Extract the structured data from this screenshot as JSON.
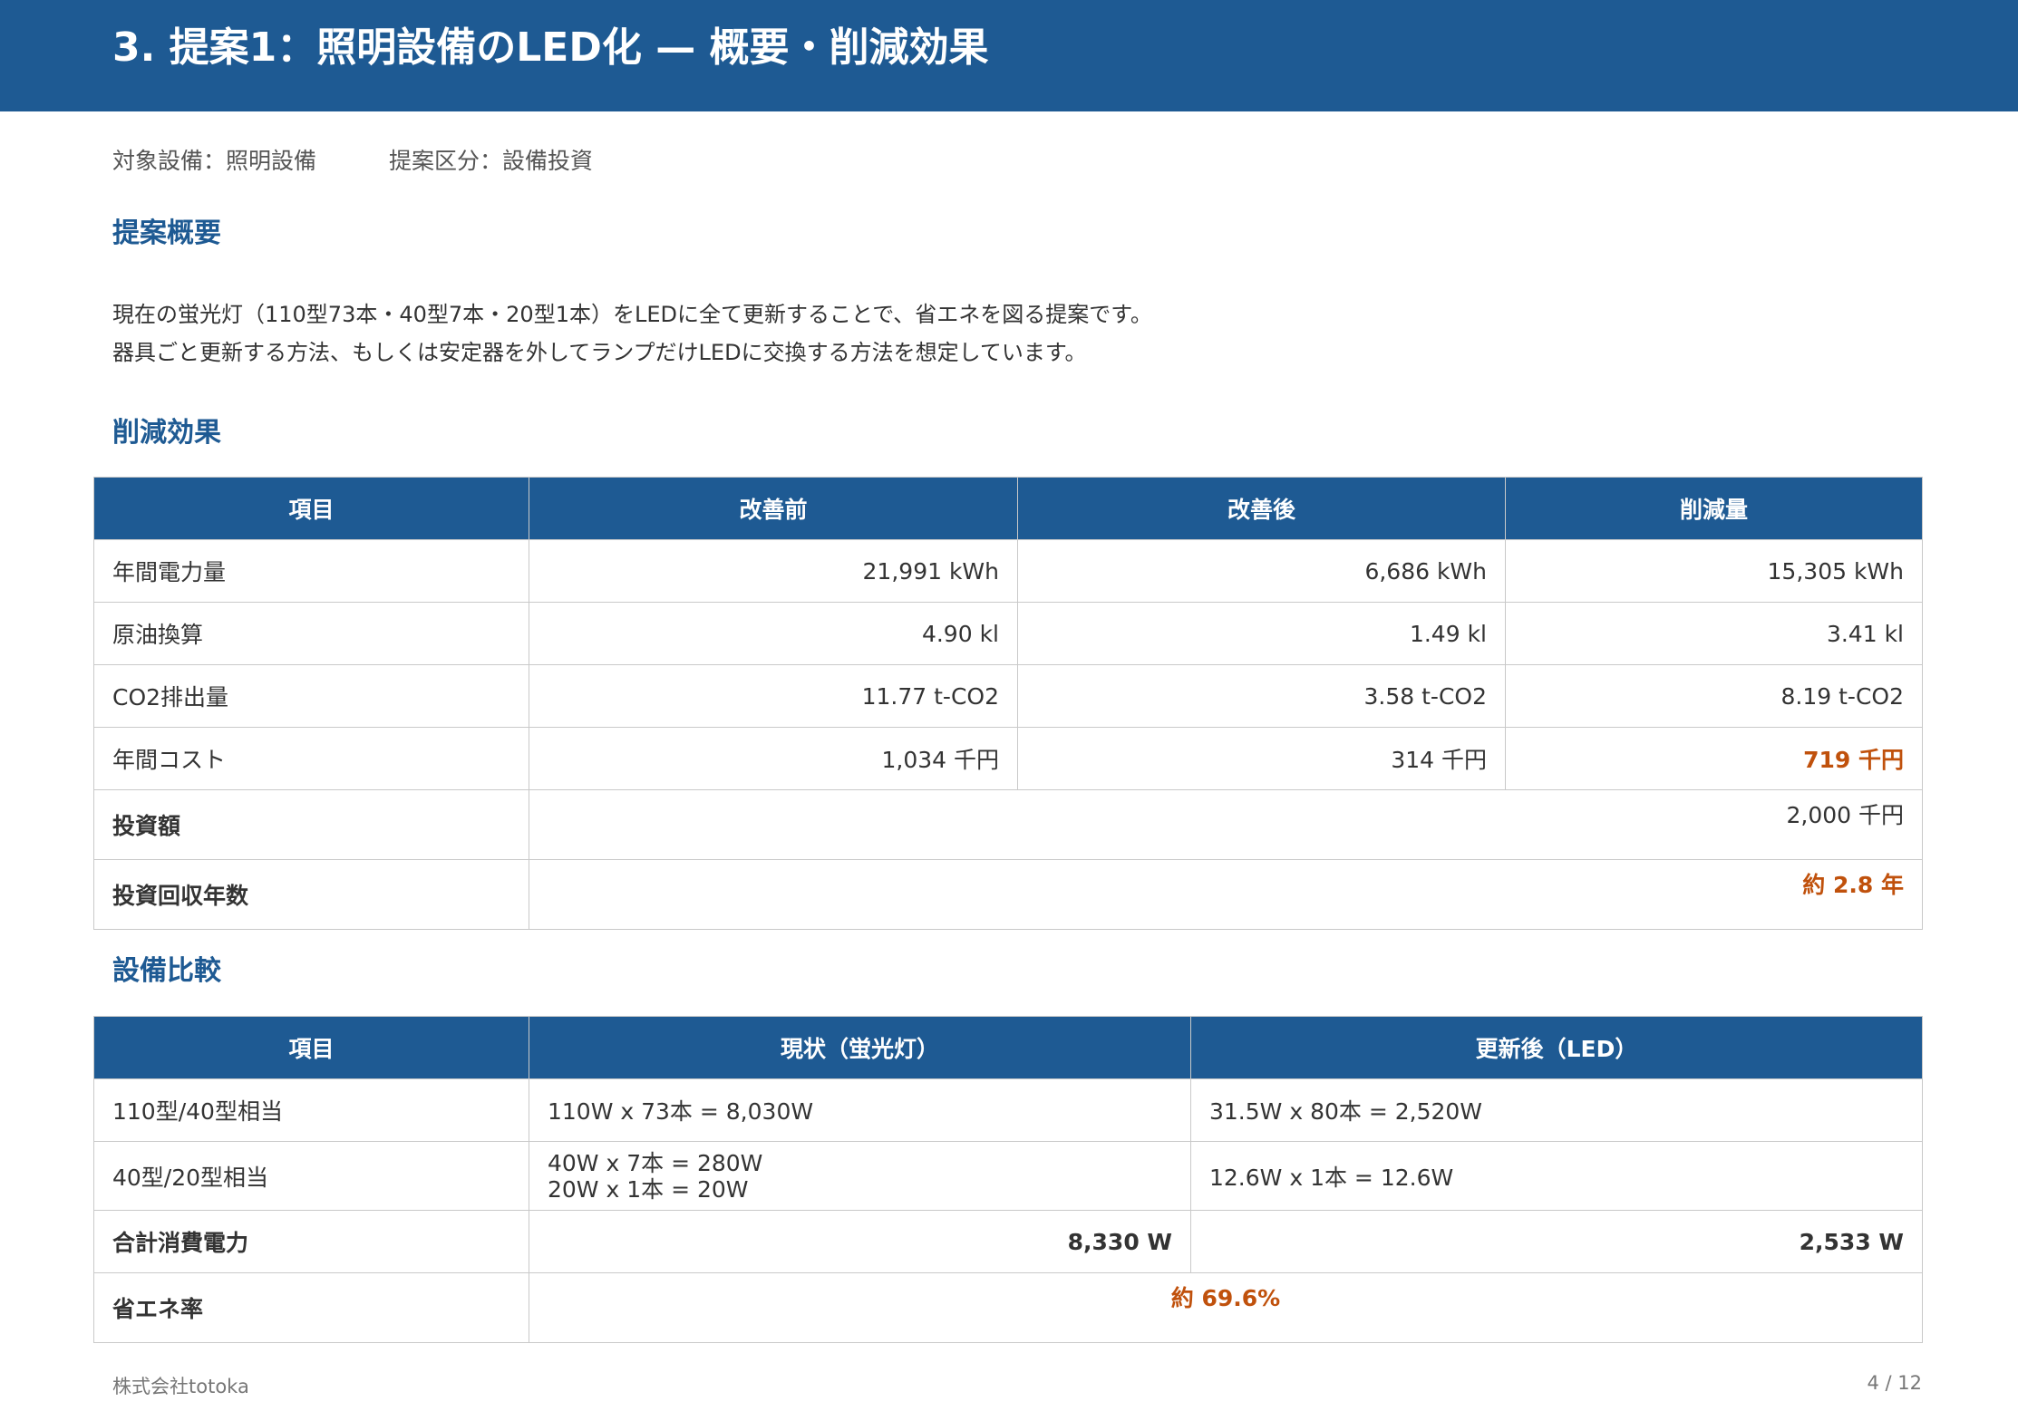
{
  "header": {
    "title": "3. 提案1：照明設備のLED化 — 概要・削減効果"
  },
  "meta": {
    "target": "対象設備：照明設備",
    "category": "提案区分：設備投資"
  },
  "sections": {
    "summary_title": "提案概要",
    "effect_title": "削減効果",
    "compare_title": "設備比較"
  },
  "summary": {
    "line1": "現在の蛍光灯（110型73本・40型7本・20型1本）をLEDに全て更新することで、省エネを図る提案です。",
    "line2": "器具ごと更新する方法、もしくは安定器を外してランプだけLEDに交換する方法を想定しています。"
  },
  "effect_table": {
    "headers": [
      "項目",
      "改善前",
      "改善後",
      "削減量"
    ],
    "rows": [
      {
        "item": "年間電力量",
        "before": "21,991 kWh",
        "after": "6,686 kWh",
        "reduction": "15,305 kWh"
      },
      {
        "item": "原油換算",
        "before": "4.90 kl",
        "after": "1.49 kl",
        "reduction": "3.41 kl"
      },
      {
        "item": "CO2排出量",
        "before": "11.77 t-CO2",
        "after": "3.58 t-CO2",
        "reduction": "8.19 t-CO2"
      },
      {
        "item": "年間コスト",
        "before": "1,034 千円",
        "after": "314 千円",
        "reduction": "719 千円"
      }
    ],
    "investment": {
      "label": "投資額",
      "value": "2,000 千円"
    },
    "payback": {
      "label": "投資回収年数",
      "value": "約 2.8 年"
    }
  },
  "compare_table": {
    "headers": [
      "項目",
      "現状（蛍光灯）",
      "更新後（LED）"
    ],
    "rows": [
      {
        "item": "110型/40型相当",
        "current": [
          "110W x 73本 = 8,030W"
        ],
        "led": "31.5W x 80本 = 2,520W"
      },
      {
        "item": "40型/20型相当",
        "current": [
          "40W x 7本 = 280W",
          "20W x 1本 = 20W"
        ],
        "led": "12.6W x 1本 = 12.6W"
      }
    ],
    "total": {
      "label": "合計消費電力",
      "current": "8,330 W",
      "led": "2,533 W"
    },
    "saving": {
      "label": "省エネ率",
      "value": "約 69.6%"
    }
  },
  "footer": {
    "company": "株式会社totoka",
    "page": "4 / 12"
  },
  "colors": {
    "primary": "#1e5a93",
    "accent": "#c0510c"
  }
}
